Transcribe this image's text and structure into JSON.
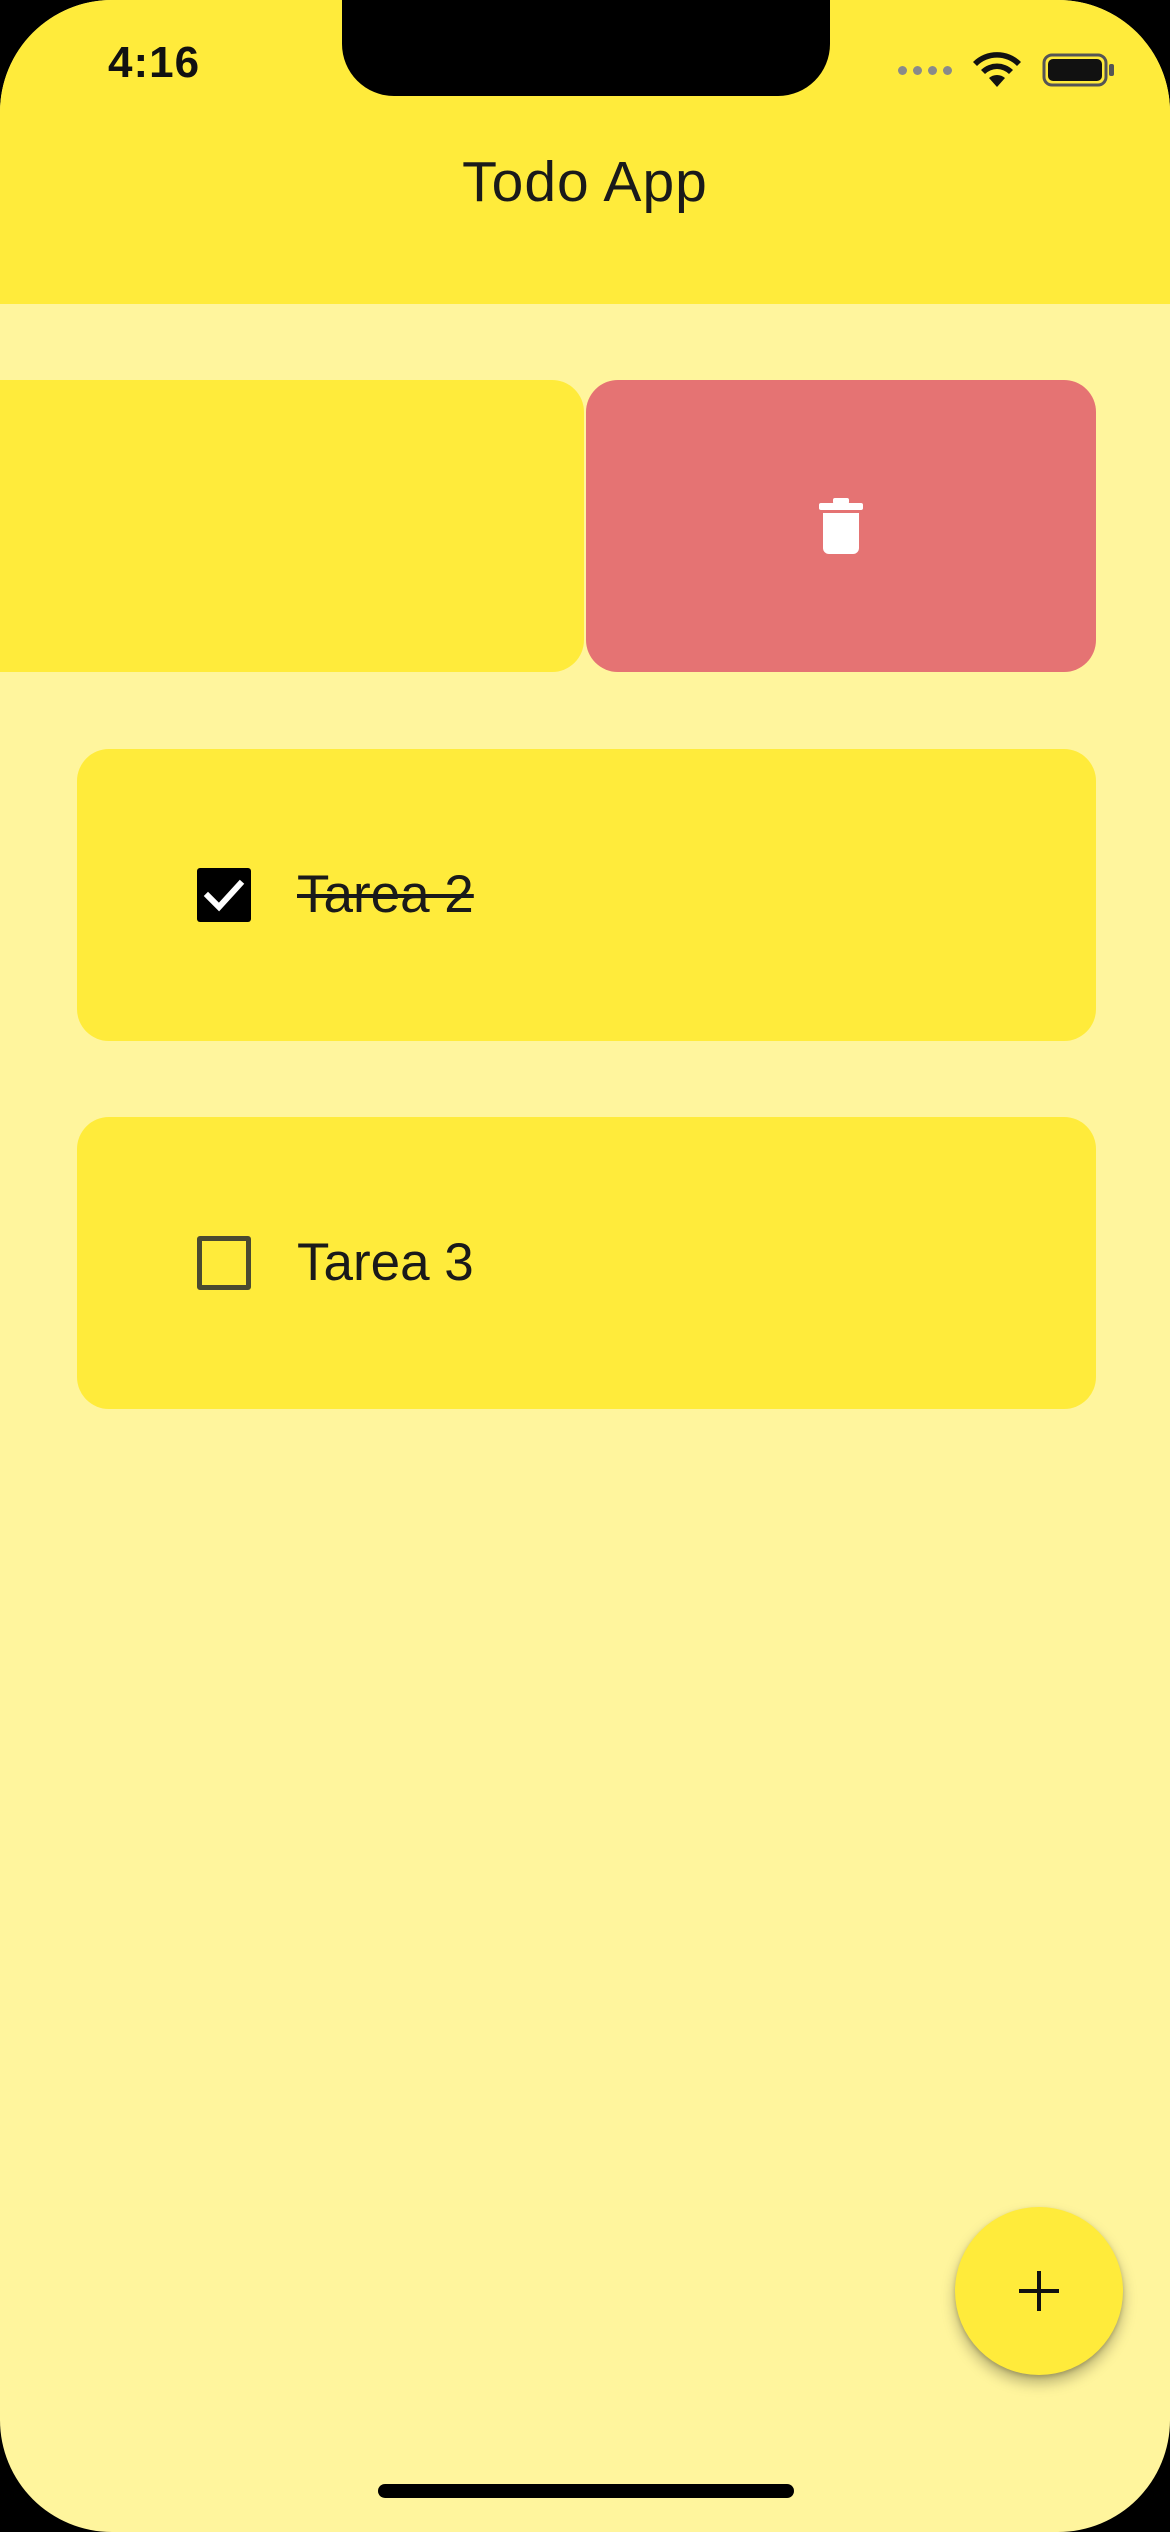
{
  "status_bar": {
    "time": "4:16"
  },
  "app_bar": {
    "title": "Todo App"
  },
  "swipe_action": {
    "icon": "trash-icon",
    "color": "#E57373"
  },
  "todos": [
    {
      "label": "Tarea 2",
      "checked": true
    },
    {
      "label": "Tarea 3",
      "checked": false
    }
  ],
  "fab": {
    "icon": "plus-icon",
    "label": "+"
  },
  "colors": {
    "app_bar": "#FFEB3B",
    "background": "#FFF59D",
    "card": "#FFEB3B",
    "delete": "#E57373"
  }
}
